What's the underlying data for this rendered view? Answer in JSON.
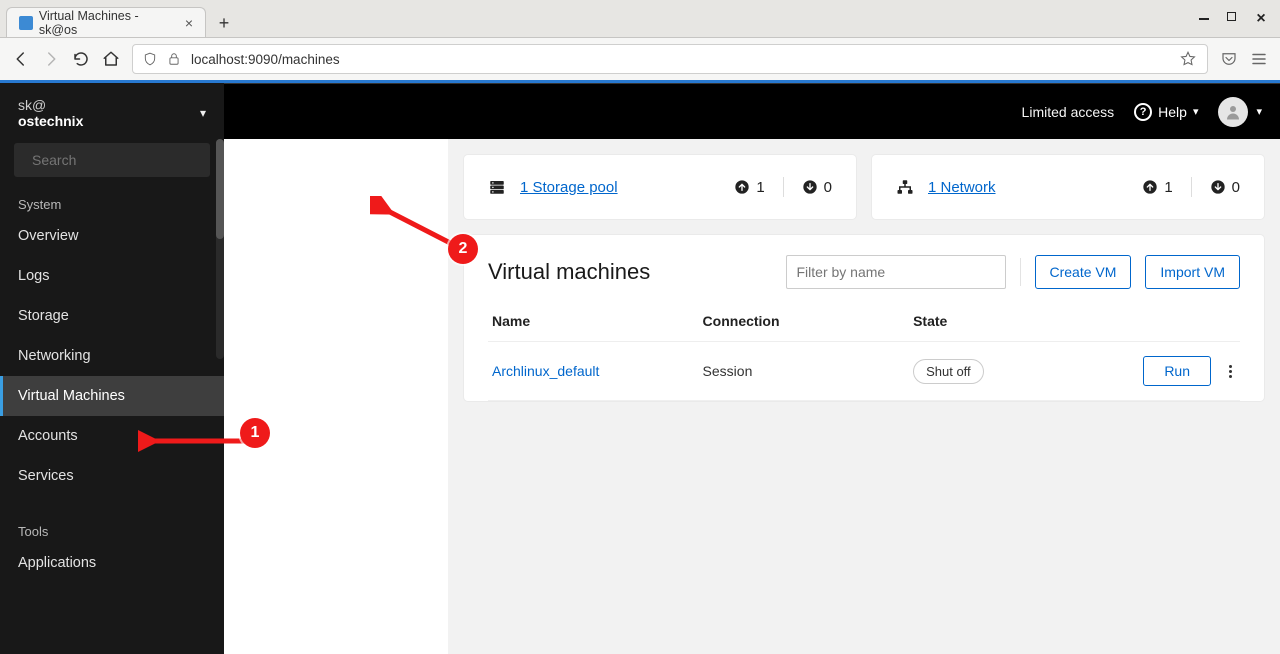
{
  "browser": {
    "tab_title": "Virtual Machines - sk@os",
    "url_display": "localhost:9090/machines",
    "url_host_muted": "localhost",
    "url_rest": ":9090/machines"
  },
  "topbar": {
    "limited_label": "Limited access",
    "help_label": "Help"
  },
  "sidebar": {
    "user": "sk@",
    "hostname": "ostechnix",
    "search_placeholder": "Search",
    "group_system": "System",
    "items_system": [
      "Overview",
      "Logs",
      "Storage",
      "Networking",
      "Virtual Machines",
      "Accounts",
      "Services"
    ],
    "active_index": 4,
    "group_tools": "Tools",
    "items_tools": [
      "Applications"
    ]
  },
  "cards": {
    "storage": {
      "link_text": "1 Storage pool",
      "up": "1",
      "down": "0"
    },
    "network": {
      "link_text": "1 Network",
      "up": "1",
      "down": "0"
    }
  },
  "vm_panel": {
    "title": "Virtual machines",
    "filter_placeholder": "Filter by name",
    "create_label": "Create VM",
    "import_label": "Import VM",
    "cols": {
      "name": "Name",
      "connection": "Connection",
      "state": "State"
    },
    "rows": [
      {
        "name": "Archlinux_default",
        "connection": "Session",
        "state": "Shut off",
        "action": "Run"
      }
    ]
  },
  "annotations": {
    "num1": "1",
    "num2": "2"
  }
}
